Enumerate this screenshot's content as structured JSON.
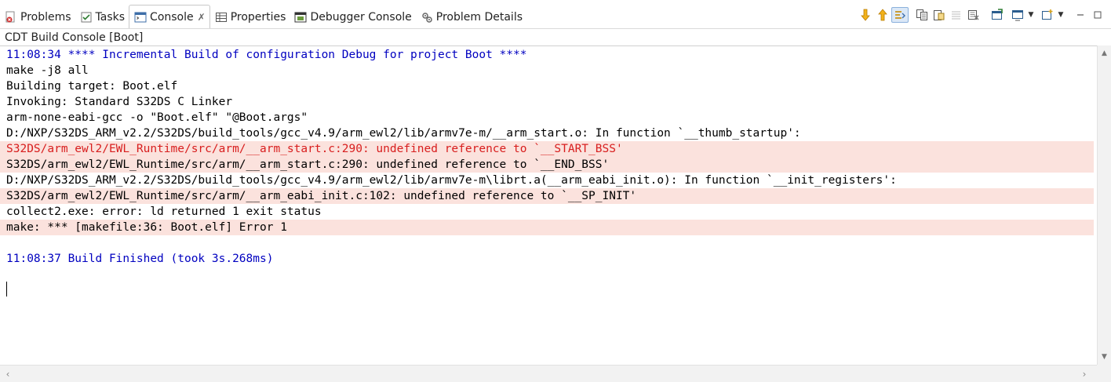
{
  "tabs": [
    {
      "label": "Problems",
      "icon": "problems-icon",
      "active": false
    },
    {
      "label": "Tasks",
      "icon": "tasks-icon",
      "active": false
    },
    {
      "label": "Console",
      "icon": "console-icon",
      "active": true,
      "close": "✗"
    },
    {
      "label": "Properties",
      "icon": "properties-icon",
      "active": false
    },
    {
      "label": "Debugger Console",
      "icon": "debugger-console-icon",
      "active": false
    },
    {
      "label": "Problem Details",
      "icon": "problem-details-icon",
      "active": false
    }
  ],
  "toolbar": [
    "arrow-down-icon",
    "arrow-up-icon",
    "link-icon",
    "copy-icon",
    "paste-icon",
    "clear-icon",
    "remove-icon",
    "open-console-icon",
    "display-console-icon",
    "new-console-icon",
    "minimize-icon",
    "maximize-icon"
  ],
  "console": {
    "title": "CDT Build Console [Boot]",
    "lines": [
      {
        "text": "11:08:34 **** Incremental Build of configuration Debug for project Boot ****",
        "kind": "info"
      },
      {
        "text": "make -j8 all",
        "kind": "normal"
      },
      {
        "text": "Building target: Boot.elf",
        "kind": "normal"
      },
      {
        "text": "Invoking: Standard S32DS C Linker",
        "kind": "normal"
      },
      {
        "text": "arm-none-eabi-gcc -o \"Boot.elf\" \"@Boot.args\"",
        "kind": "normal"
      },
      {
        "text": "D:/NXP/S32DS_ARM_v2.2/S32DS/build_tools/gcc_v4.9/arm_ewl2/lib/armv7e-m/__arm_start.o: In function `__thumb_startup':",
        "kind": "normal"
      },
      {
        "text": "S32DS/arm_ewl2/EWL_Runtime/src/arm/__arm_start.c:290: undefined reference to `__START_BSS'",
        "kind": "error-red"
      },
      {
        "text": "S32DS/arm_ewl2/EWL_Runtime/src/arm/__arm_start.c:290: undefined reference to `__END_BSS'",
        "kind": "error"
      },
      {
        "text": "D:/NXP/S32DS_ARM_v2.2/S32DS/build_tools/gcc_v4.9/arm_ewl2/lib/armv7e-m\\librt.a(__arm_eabi_init.o): In function `__init_registers':",
        "kind": "normal"
      },
      {
        "text": "S32DS/arm_ewl2/EWL_Runtime/src/arm/__arm_eabi_init.c:102: undefined reference to `__SP_INIT'",
        "kind": "error"
      },
      {
        "text": "collect2.exe: error: ld returned 1 exit status",
        "kind": "normal"
      },
      {
        "text": "make: *** [makefile:36: Boot.elf] Error 1",
        "kind": "error"
      },
      {
        "text": "",
        "kind": "normal"
      },
      {
        "text": "11:08:37 Build Finished (took 3s.268ms)",
        "kind": "info"
      }
    ]
  },
  "colors": {
    "info_text": "#0000c0",
    "error_text": "#d81e1e",
    "error_background": "#fbe2dd"
  }
}
